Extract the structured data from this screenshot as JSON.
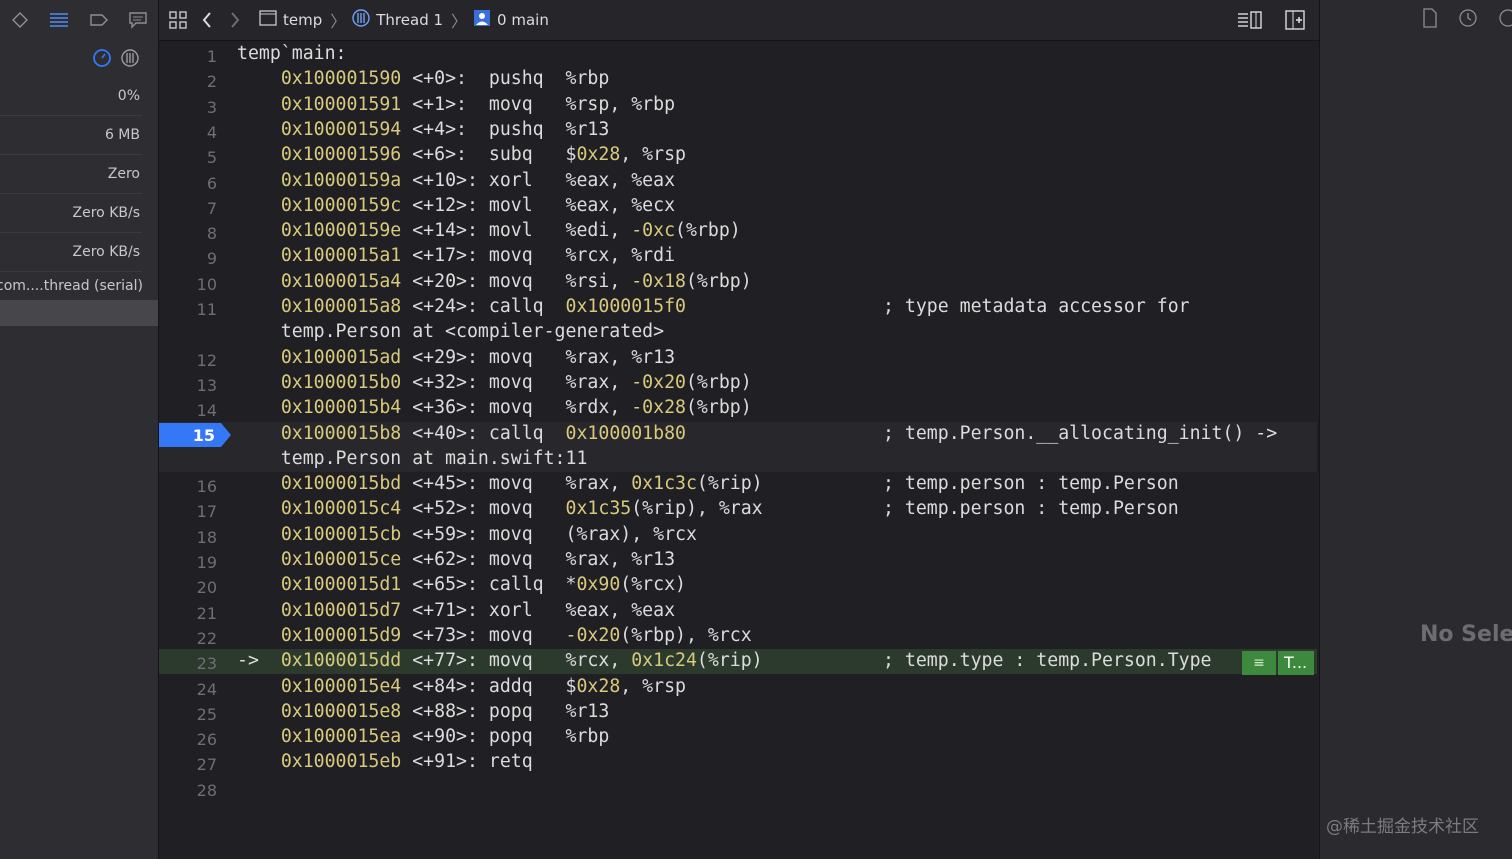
{
  "jumpbar": {
    "crumbs": [
      "temp",
      "Thread 1",
      "0 main"
    ]
  },
  "navigator": {
    "stats": [
      "0%",
      "6 MB",
      "Zero",
      "Zero KB/s",
      "Zero KB/s"
    ],
    "thread_label": "com....thread (serial)"
  },
  "code": {
    "lines": [
      {
        "n": "1",
        "addr": "",
        "off": "",
        "op": "",
        "args": "",
        "comment": "",
        "raw": "temp`main:"
      },
      {
        "n": "2",
        "addr": "0x100001590",
        "off": "<+0>:",
        "op": "pushq",
        "args": "%rbp",
        "comment": ""
      },
      {
        "n": "3",
        "addr": "0x100001591",
        "off": "<+1>:",
        "op": "movq",
        "args": "%rsp, %rbp",
        "comment": ""
      },
      {
        "n": "4",
        "addr": "0x100001594",
        "off": "<+4>:",
        "op": "pushq",
        "args": "%r13",
        "comment": ""
      },
      {
        "n": "5",
        "addr": "0x100001596",
        "off": "<+6>:",
        "op": "subq",
        "args": "$0x28, %rsp",
        "comment": ""
      },
      {
        "n": "6",
        "addr": "0x10000159a",
        "off": "<+10>:",
        "op": "xorl",
        "args": "%eax, %eax",
        "comment": ""
      },
      {
        "n": "7",
        "addr": "0x10000159c",
        "off": "<+12>:",
        "op": "movl",
        "args": "%eax, %ecx",
        "comment": ""
      },
      {
        "n": "8",
        "addr": "0x10000159e",
        "off": "<+14>:",
        "op": "movl",
        "args": "%edi, -0xc(%rbp)",
        "comment": ""
      },
      {
        "n": "9",
        "addr": "0x1000015a1",
        "off": "<+17>:",
        "op": "movq",
        "args": "%rcx, %rdi",
        "comment": ""
      },
      {
        "n": "10",
        "addr": "0x1000015a4",
        "off": "<+20>:",
        "op": "movq",
        "args": "%rsi, -0x18(%rbp)",
        "comment": ""
      },
      {
        "n": "11",
        "addr": "0x1000015a8",
        "off": "<+24>:",
        "op": "callq",
        "args": "0x1000015f0",
        "comment": "; type metadata accessor for"
      },
      {
        "n": "",
        "addr": "",
        "off": "",
        "op": "",
        "args": "",
        "comment": "",
        "raw": "    temp.Person at <compiler-generated>"
      },
      {
        "n": "12",
        "addr": "0x1000015ad",
        "off": "<+29>:",
        "op": "movq",
        "args": "%rax, %r13",
        "comment": ""
      },
      {
        "n": "13",
        "addr": "0x1000015b0",
        "off": "<+32>:",
        "op": "movq",
        "args": "%rax, -0x20(%rbp)",
        "comment": ""
      },
      {
        "n": "14",
        "addr": "0x1000015b4",
        "off": "<+36>:",
        "op": "movq",
        "args": "%rdx, -0x28(%rbp)",
        "comment": ""
      },
      {
        "n": "15",
        "addr": "0x1000015b8",
        "off": "<+40>:",
        "op": "callq",
        "args": "0x100001b80",
        "comment": "; temp.Person.__allocating_init() ->"
      },
      {
        "n": "",
        "addr": "",
        "off": "",
        "op": "",
        "args": "",
        "comment": "",
        "raw": "    temp.Person at main.swift:11"
      },
      {
        "n": "16",
        "addr": "0x1000015bd",
        "off": "<+45>:",
        "op": "movq",
        "args": "%rax, 0x1c3c(%rip)",
        "comment": "; temp.person : temp.Person"
      },
      {
        "n": "17",
        "addr": "0x1000015c4",
        "off": "<+52>:",
        "op": "movq",
        "args": "0x1c35(%rip), %rax",
        "comment": "; temp.person : temp.Person"
      },
      {
        "n": "18",
        "addr": "0x1000015cb",
        "off": "<+59>:",
        "op": "movq",
        "args": "(%rax), %rcx",
        "comment": ""
      },
      {
        "n": "19",
        "addr": "0x1000015ce",
        "off": "<+62>:",
        "op": "movq",
        "args": "%rax, %r13",
        "comment": ""
      },
      {
        "n": "20",
        "addr": "0x1000015d1",
        "off": "<+65>:",
        "op": "callq",
        "args": "*0x90(%rcx)",
        "comment": ""
      },
      {
        "n": "21",
        "addr": "0x1000015d7",
        "off": "<+71>:",
        "op": "xorl",
        "args": "%eax, %eax",
        "comment": ""
      },
      {
        "n": "22",
        "addr": "0x1000015d9",
        "off": "<+73>:",
        "op": "movq",
        "args": "-0x20(%rbp), %rcx",
        "comment": ""
      },
      {
        "n": "23",
        "addr": "0x1000015dd",
        "off": "<+77>:",
        "op": "movq",
        "args": "%rcx, 0x1c24(%rip)",
        "comment": "; temp.type : temp.Person.Type"
      },
      {
        "n": "24",
        "addr": "0x1000015e4",
        "off": "<+84>:",
        "op": "addq",
        "args": "$0x28, %rsp",
        "comment": ""
      },
      {
        "n": "25",
        "addr": "0x1000015e8",
        "off": "<+88>:",
        "op": "popq",
        "args": "%r13",
        "comment": ""
      },
      {
        "n": "26",
        "addr": "0x1000015ea",
        "off": "<+90>:",
        "op": "popq",
        "args": "%rbp",
        "comment": ""
      },
      {
        "n": "27",
        "addr": "0x1000015eb",
        "off": "<+91>:",
        "op": "retq",
        "args": "",
        "comment": ""
      },
      {
        "n": "28",
        "addr": "",
        "off": "",
        "op": "",
        "args": "",
        "comment": "",
        "raw": ""
      }
    ],
    "breakpoint_line": "15",
    "pc_arrow": "->",
    "badge_label": "T..."
  },
  "inspector": {
    "empty_text": "No Selec"
  },
  "watermark": "@稀土掘金技术社区",
  "colors": {
    "breakpoint": "#3478f6",
    "pc_highlight": "#2b3a2c",
    "address": "#d9c97c"
  }
}
